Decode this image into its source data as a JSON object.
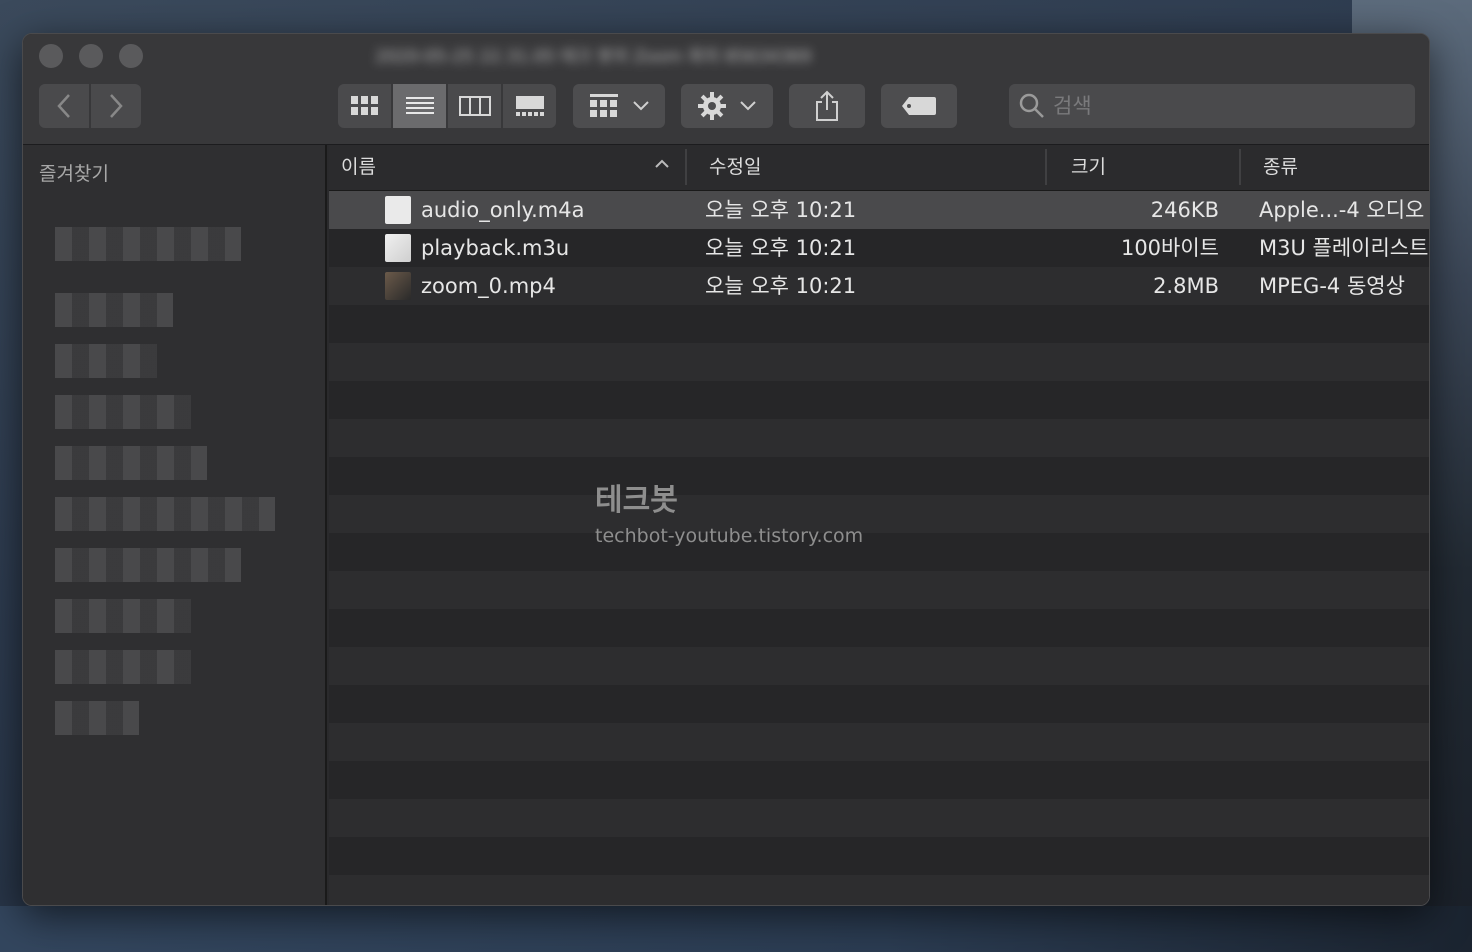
{
  "window": {
    "title": "2020-05-25 22.31.05 테크 봇의 Zoom 회의 85634369"
  },
  "toolbar": {
    "search_placeholder": "검색"
  },
  "sidebar": {
    "title": "즐겨찾기"
  },
  "columns": {
    "name": "이름",
    "date": "수정일",
    "size": "크기",
    "kind": "종류"
  },
  "files": [
    {
      "name": "audio_only.m4a",
      "date": "오늘 오후 10:21",
      "size": "246KB",
      "kind": "Apple...-4 오디오"
    },
    {
      "name": "playback.m3u",
      "date": "오늘 오후 10:21",
      "size": "100바이트",
      "kind": "M3U 플레이리스트"
    },
    {
      "name": "zoom_0.mp4",
      "date": "오늘 오후 10:21",
      "size": "2.8MB",
      "kind": "MPEG-4 동영상"
    }
  ],
  "watermark": {
    "title": "테크봇",
    "url": "techbot-youtube.tistory.com"
  }
}
